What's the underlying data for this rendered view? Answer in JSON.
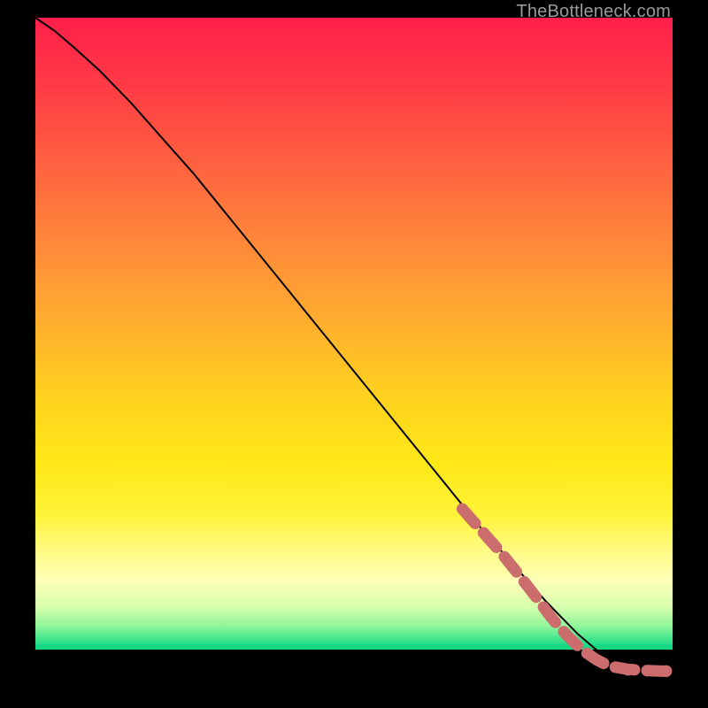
{
  "watermark": "TheBottleneck.com",
  "colors": {
    "curve": "#000000",
    "dots": "#cc6d6d",
    "dot_fill": "#cc6d6d",
    "bg_black": "#000000"
  },
  "chart_data": {
    "type": "line",
    "title": "",
    "xlabel": "",
    "ylabel": "",
    "xlim": [
      0,
      100
    ],
    "ylim": [
      0,
      100
    ],
    "grid": false,
    "legend": false,
    "series": [
      {
        "name": "curve",
        "x": [
          0,
          3,
          6,
          10,
          15,
          20,
          25,
          30,
          35,
          40,
          45,
          50,
          55,
          60,
          65,
          70,
          75,
          80,
          85,
          88,
          90,
          92,
          94,
          96,
          98,
          100
        ],
        "y": [
          100,
          98,
          95.5,
          92,
          87,
          81.5,
          76,
          70,
          64,
          58,
          52,
          46,
          40,
          34,
          28,
          22,
          16.5,
          11,
          6,
          3.5,
          2,
          1,
          0.5,
          0.25,
          0.1,
          0
        ]
      }
    ],
    "dots_segment": {
      "name": "dotted-overlay",
      "note": "thicker dotted pink segment overlaying the lower-right tail of the curve",
      "x": [
        67,
        69,
        71,
        73,
        75,
        77,
        79,
        80.5,
        82,
        83.5,
        85,
        86.5,
        88,
        90,
        93,
        96,
        99
      ],
      "y": [
        25,
        22.8,
        20.6,
        18.4,
        16,
        13.5,
        11,
        9,
        7.2,
        5.6,
        4.2,
        3.0,
        2.0,
        1.0,
        0.5,
        0.3,
        0.2
      ]
    }
  }
}
